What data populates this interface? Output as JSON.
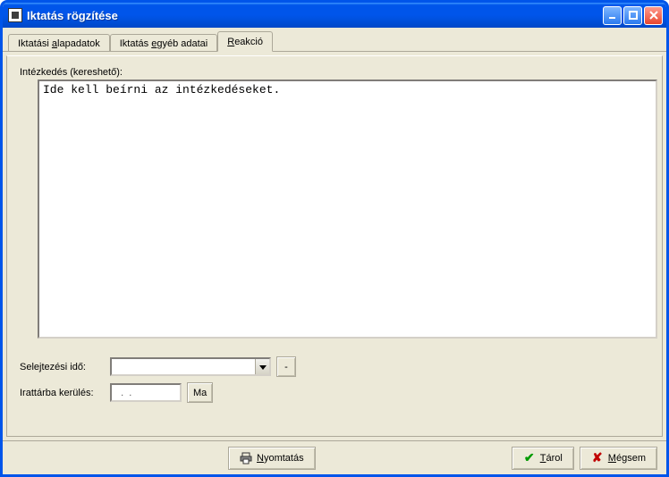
{
  "window": {
    "title": "Iktatás rögzítése"
  },
  "tabs": {
    "t1_pre": "Iktatási ",
    "t1_u": "a",
    "t1_post": "lapadatok",
    "t2_pre": "Iktatás ",
    "t2_u": "e",
    "t2_post": "gyéb adatai",
    "t3_pre": "",
    "t3_u": "R",
    "t3_post": "eakció"
  },
  "main": {
    "intezkedes_label": "Intézkedés (kereshető):",
    "intezkedes_text": "Ide kell beírni az intézkedéseket.",
    "selejt_label": "Selejtezési idő:",
    "selejt_value": "",
    "selejt_clear": "-",
    "irattar_label": "Irattárba kerülés:",
    "irattar_value": "  .  .",
    "ma_label": "Ma"
  },
  "buttons": {
    "print_pre": "",
    "print_u": "N",
    "print_post": "yomtatás",
    "save_pre": "",
    "save_u": "T",
    "save_post": "árol",
    "cancel_pre": "",
    "cancel_u": "M",
    "cancel_post": "égsem"
  }
}
